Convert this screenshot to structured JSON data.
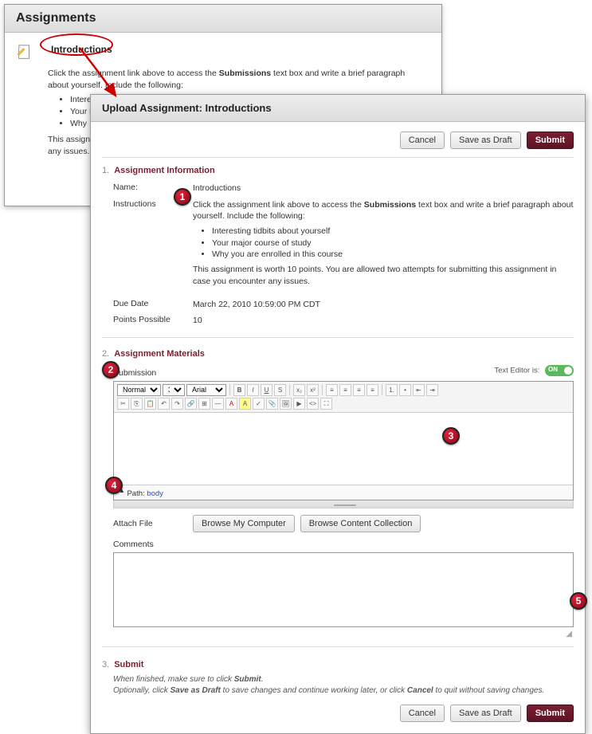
{
  "back": {
    "title": "Assignments",
    "link": "Introductions",
    "intro_pre": "Click the assignment link above to access the ",
    "intro_bold": "Submissions",
    "intro_post": " text box and write a brief paragraph about yourself. Include the following:",
    "bullets": [
      "Interesting tidbits about yourself",
      "Your major course of study",
      "Why"
    ],
    "footer": "This assignment\nany issues."
  },
  "front": {
    "title": "Upload Assignment: Introductions",
    "actions": {
      "cancel": "Cancel",
      "draft": "Save as Draft",
      "submit": "Submit"
    },
    "sec1": {
      "num": "1.",
      "title": "Assignment Information"
    },
    "name_label": "Name:",
    "name_value": "Introductions",
    "instr_label": "Instructions",
    "instr_pre": "Click the assignment link above to access the ",
    "instr_bold": "Submissions",
    "instr_post": " text box and write a brief paragraph about yourself. Include the following:",
    "instr_bullets": [
      "Interesting tidbits about yourself",
      "Your major course of study",
      "Why you are enrolled in this course"
    ],
    "instr_footer": "This assignment is worth 10 points. You are allowed two attempts for submitting this assignment in case you encounter any issues.",
    "due_label": "Due Date",
    "due_value": "March 22, 2010 10:59:00 PM CDT",
    "pts_label": "Points Possible",
    "pts_value": "10",
    "sec2": {
      "num": "2.",
      "title": "Assignment Materials"
    },
    "submission_label": "Submission",
    "editor_toggle_label": "Text Editor is:",
    "editor_toggle_state": "ON",
    "tb": {
      "style": "Normal",
      "size": "3",
      "font": "Arial"
    },
    "path_label": "Path: ",
    "path_value": "body",
    "attach_label": "Attach File",
    "browse_computer": "Browse My Computer",
    "browse_collection": "Browse Content Collection",
    "comments_label": "Comments",
    "sec3": {
      "num": "3.",
      "title": "Submit"
    },
    "submit_line1_pre": "When finished, make sure to click ",
    "submit_line1_bold": "Submit",
    "submit_line1_post": ".",
    "submit_line2_pre": "Optionally, click ",
    "submit_line2_b1": "Save as Draft",
    "submit_line2_mid": " to save changes and continue working later, or click ",
    "submit_line2_b2": "Cancel",
    "submit_line2_post": " to quit without saving changes."
  },
  "markers": {
    "m1": "1",
    "m2": "2",
    "m3": "3",
    "m4": "4",
    "m5": "5"
  }
}
